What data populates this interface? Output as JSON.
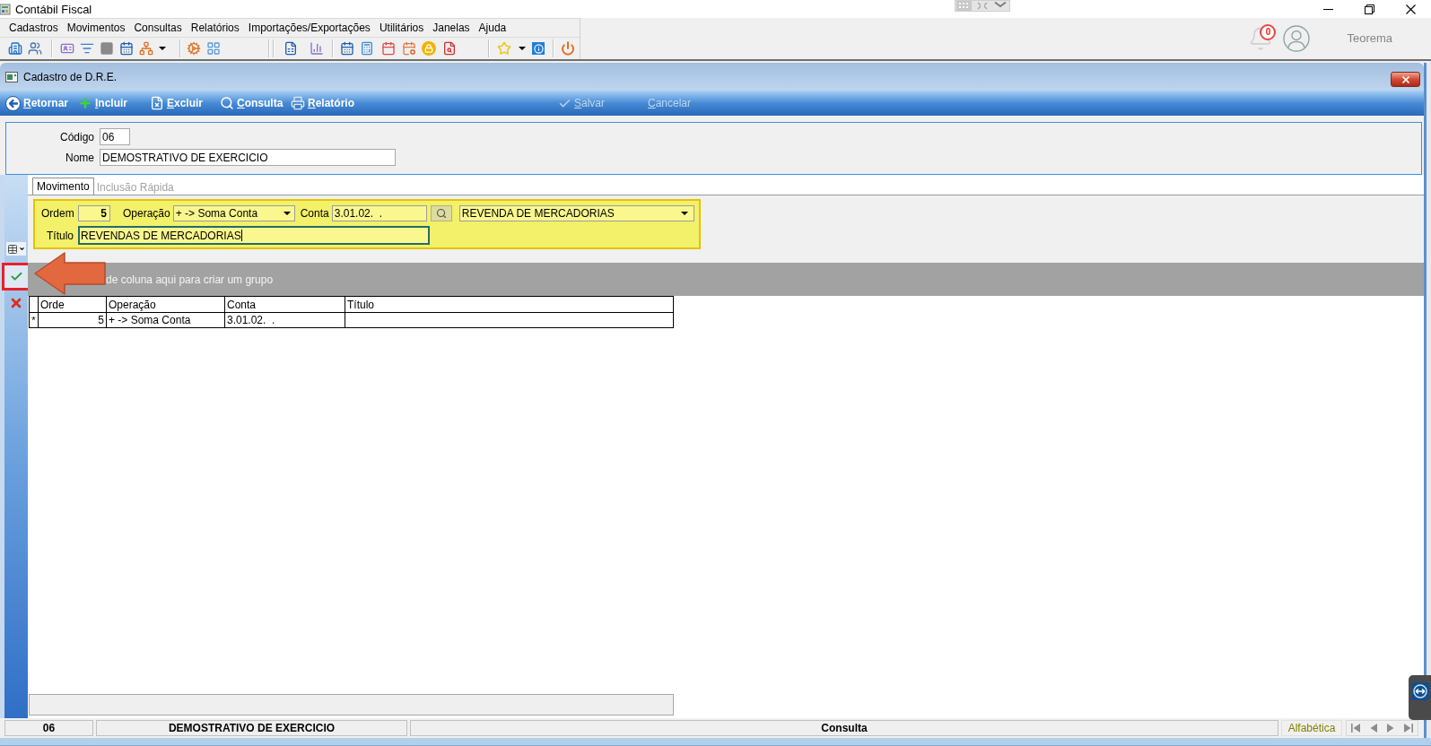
{
  "app": {
    "title": "Contábil Fiscal"
  },
  "menu": [
    "Cadastros",
    "Movimentos",
    "Consultas",
    "Relatórios",
    "Importações/Exportações",
    "Utilitários",
    "Janelas",
    "Ajuda"
  ],
  "notifications": {
    "count": "0"
  },
  "user": {
    "name": "Teorema"
  },
  "form_window": {
    "title": "Cadastro de D.R.E."
  },
  "actions": [
    {
      "kind": "back",
      "label": "Retornar",
      "disabled": false
    },
    {
      "kind": "add",
      "label": "Incluir",
      "disabled": false
    },
    {
      "kind": "delete",
      "label": "Excluir",
      "disabled": false
    },
    {
      "kind": "search",
      "label": "Consulta",
      "disabled": false
    },
    {
      "kind": "print",
      "label": "Relatório",
      "disabled": false
    },
    {
      "kind": "save",
      "label": "Salvar",
      "disabled": true
    },
    {
      "kind": "cancel",
      "label": "Cancelar",
      "disabled": true
    }
  ],
  "header_fields": [
    {
      "kind": "short",
      "label": "Código",
      "value": "06"
    },
    {
      "kind": "long",
      "label": "Nome",
      "value": "DEMOSTRATIVO DE EXERCICIO"
    }
  ],
  "tabs": [
    {
      "label": "Movimento",
      "selected": true
    },
    {
      "label": "Inclusão Rápida",
      "selected": false
    }
  ],
  "entry": {
    "ordem": {
      "label": "Ordem",
      "value": "5"
    },
    "operacao": {
      "label": "Operação",
      "value": "+ -> Soma Conta"
    },
    "conta": {
      "label": "Conta",
      "value": "3.01.02.  ."
    },
    "conta_nome": {
      "value": "REVENDA DE MERCADORIAS"
    },
    "titulo": {
      "label": "Título",
      "value": "REVENDAS DE MERCADORIAS",
      "focused": true
    }
  },
  "group_panel": {
    "hint": "de coluna aqui para criar um grupo"
  },
  "grid": {
    "columns": [
      "Orde",
      "Operação",
      "Conta",
      "Título"
    ],
    "rows": [
      {
        "indicator": "*",
        "ordem": "5",
        "operacao": "+ -> Soma Conta",
        "conta": "3.01.02.  ."
      }
    ]
  },
  "status_bar": {
    "code": "06",
    "name": "DEMOSTRATIVO DE EXERCICIO",
    "mode": "Consulta",
    "order": "Alfabética"
  }
}
